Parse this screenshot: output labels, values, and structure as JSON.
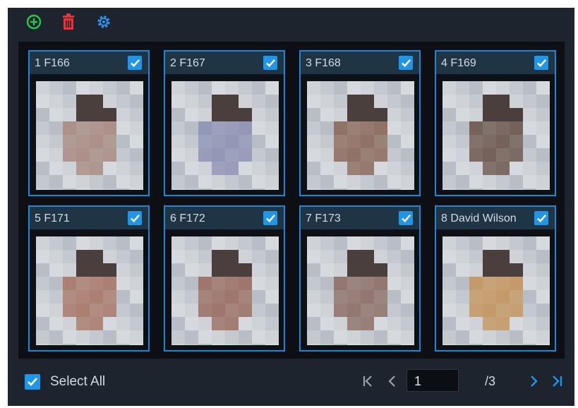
{
  "toolbar": {
    "buttons": [
      {
        "name": "add-icon",
        "color": "#28c94a"
      },
      {
        "name": "trash-icon",
        "color": "#e8333a"
      },
      {
        "name": "gear-icon",
        "color": "#2f8fe6"
      }
    ]
  },
  "faces": [
    {
      "label": "1 F166",
      "checked": true,
      "tone": "#a88c84"
    },
    {
      "label": "2 F167",
      "checked": true,
      "tone": "#8f94b4"
    },
    {
      "label": "3 F168",
      "checked": true,
      "tone": "#8c6c5e"
    },
    {
      "label": "4 F169",
      "checked": true,
      "tone": "#6e5a52"
    },
    {
      "label": "5 F171",
      "checked": true,
      "tone": "#a87a6a"
    },
    {
      "label": "6 F172",
      "checked": true,
      "tone": "#9a7064"
    },
    {
      "label": "7 F173",
      "checked": true,
      "tone": "#8e726a"
    },
    {
      "label": "8 David Wilson",
      "checked": true,
      "tone": "#c39663"
    }
  ],
  "footer": {
    "select_all_label": "Select All",
    "select_all_checked": true,
    "page_value": "1",
    "page_total": "/3"
  },
  "colors": {
    "accent": "#2196e9",
    "panel_bg": "#1d242d",
    "grid_bg": "#0c0f14"
  }
}
